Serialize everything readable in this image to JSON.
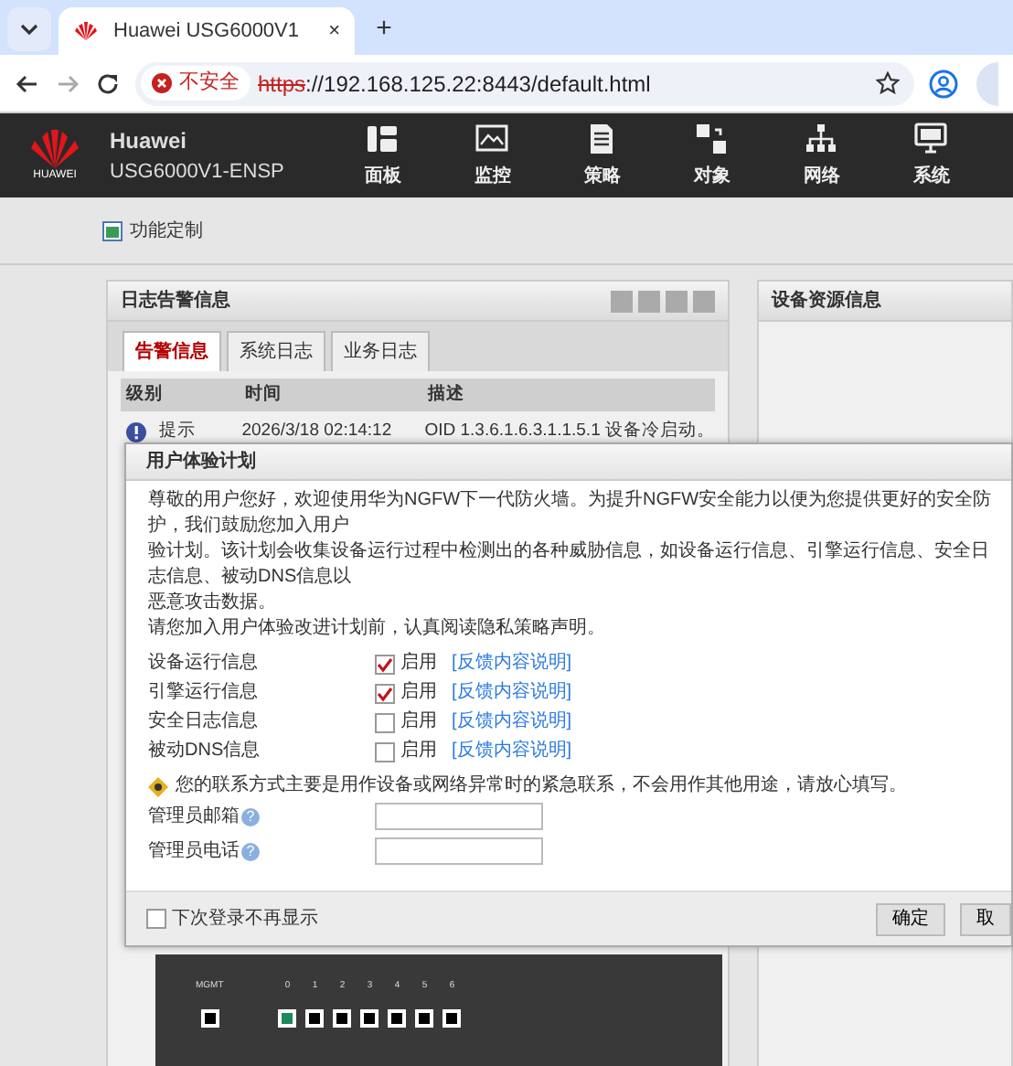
{
  "browser": {
    "tab_title": "Huawei USG6000V1",
    "close_mark": "×",
    "new_tab_mark": "+",
    "security_label": "不安全",
    "url_scheme": "https",
    "url_rest": "://192.168.125.22:8443/default.html"
  },
  "app": {
    "logo_text": "HUAWEI",
    "brand": "Huawei",
    "model": "USG6000V1-ENSP",
    "nav": [
      {
        "label": "面板"
      },
      {
        "label": "监控"
      },
      {
        "label": "策略"
      },
      {
        "label": "对象"
      },
      {
        "label": "网络"
      },
      {
        "label": "系统"
      }
    ]
  },
  "toolbar": {
    "link": "功能定制"
  },
  "log_panel": {
    "title": "日志告警信息",
    "tabs": [
      {
        "label": "告警信息",
        "selected": true
      },
      {
        "label": "系统日志",
        "selected": false
      },
      {
        "label": "业务日志",
        "selected": false
      }
    ],
    "columns": [
      "级别",
      "时间",
      "描述"
    ],
    "rows": [
      {
        "level": "提示",
        "time": "2026/3/18 02:14:12",
        "description": "OID 1.3.6.1.6.3.1.1.5.1 设备冷启动。"
      }
    ]
  },
  "resource_panel": {
    "title": "设备资源信息"
  },
  "device": {
    "mgmt_label": "MGMT",
    "ports": [
      {
        "label": "0",
        "active": true
      },
      {
        "label": "1",
        "active": false
      },
      {
        "label": "2",
        "active": false
      },
      {
        "label": "3",
        "active": false
      },
      {
        "label": "4",
        "active": false
      },
      {
        "label": "5",
        "active": false
      },
      {
        "label": "6",
        "active": false
      }
    ]
  },
  "dialog": {
    "title": "用户体验计划",
    "intro_lines": [
      "尊敬的用户您好，欢迎使用华为NGFW下一代防火墙。为提升NGFW安全能力以便为您提供更好的安全防护，我们鼓励您加入用户",
      "验计划。该计划会收集设备运行过程中检测出的各种威胁信息，如设备运行信息、引擎运行信息、安全日志信息、被动DNS信息以",
      "恶意攻击数据。",
      "请您加入用户体验改进计划前，认真阅读隐私策略声明。"
    ],
    "options": [
      {
        "label": "设备运行信息",
        "checked": true,
        "enable_label": "启用",
        "link": "[反馈内容说明]"
      },
      {
        "label": "引擎运行信息",
        "checked": true,
        "enable_label": "启用",
        "link": "[反馈内容说明]"
      },
      {
        "label": "安全日志信息",
        "checked": false,
        "enable_label": "启用",
        "link": "[反馈内容说明]"
      },
      {
        "label": "被动DNS信息",
        "checked": false,
        "enable_label": "启用",
        "link": "[反馈内容说明]"
      }
    ],
    "note": "您的联系方式主要是用作设备或网络异常时的紧急联系，不会用作其他用途，请放心填写。",
    "fields": [
      {
        "label": "管理员邮箱",
        "help_mark": "?"
      },
      {
        "label": "管理员电话",
        "help_mark": "?"
      }
    ],
    "dont_show": {
      "label": "下次登录不再显示",
      "checked": false
    },
    "buttons": [
      "确定",
      "取"
    ]
  }
}
